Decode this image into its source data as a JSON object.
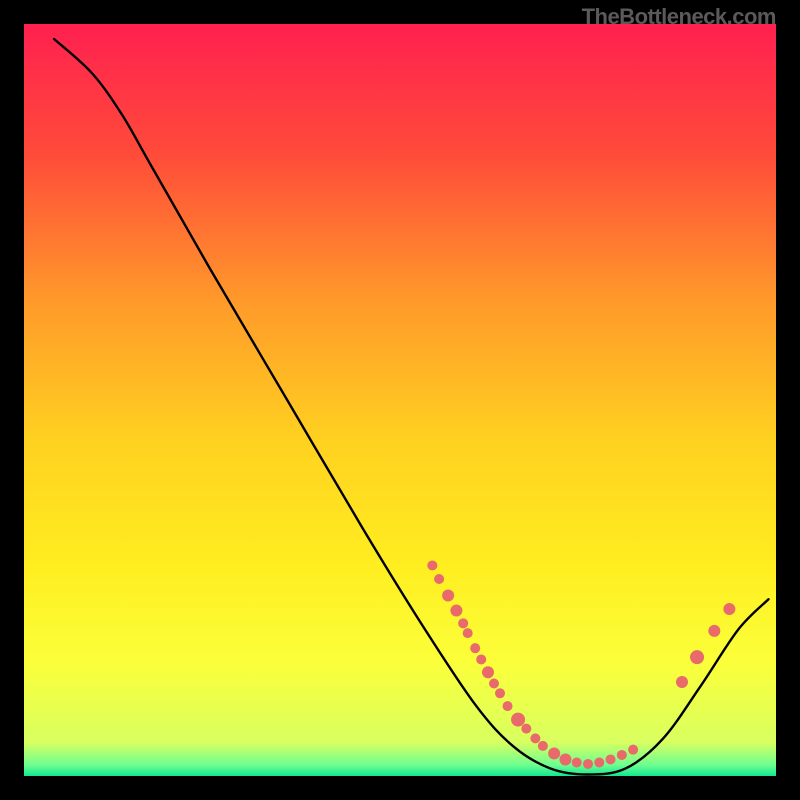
{
  "watermark": "TheBottleneck.com",
  "chart_data": {
    "type": "line",
    "title": "",
    "xlabel": "",
    "ylabel": "",
    "xlim": [
      0,
      100
    ],
    "ylim": [
      0,
      100
    ],
    "gradient_stops": [
      {
        "offset": 0.0,
        "color": "#ff2050"
      },
      {
        "offset": 0.17,
        "color": "#ff4a3a"
      },
      {
        "offset": 0.37,
        "color": "#ff9a2a"
      },
      {
        "offset": 0.55,
        "color": "#ffd020"
      },
      {
        "offset": 0.72,
        "color": "#ffee20"
      },
      {
        "offset": 0.85,
        "color": "#fbff3a"
      },
      {
        "offset": 0.955,
        "color": "#d8ff60"
      },
      {
        "offset": 0.985,
        "color": "#70ff90"
      },
      {
        "offset": 1.0,
        "color": "#10e890"
      }
    ],
    "curve": [
      {
        "x": 4.0,
        "y": 98.0
      },
      {
        "x": 9.0,
        "y": 93.5
      },
      {
        "x": 13.0,
        "y": 88.0
      },
      {
        "x": 17.0,
        "y": 81.0
      },
      {
        "x": 25.0,
        "y": 67.0
      },
      {
        "x": 35.0,
        "y": 50.0
      },
      {
        "x": 45.0,
        "y": 33.0
      },
      {
        "x": 53.0,
        "y": 20.0
      },
      {
        "x": 60.0,
        "y": 9.5
      },
      {
        "x": 65.0,
        "y": 4.0
      },
      {
        "x": 70.0,
        "y": 1.0
      },
      {
        "x": 75.0,
        "y": 0.2
      },
      {
        "x": 80.0,
        "y": 1.0
      },
      {
        "x": 85.0,
        "y": 5.0
      },
      {
        "x": 90.0,
        "y": 12.0
      },
      {
        "x": 95.0,
        "y": 19.5
      },
      {
        "x": 99.0,
        "y": 23.5
      }
    ],
    "points": [
      {
        "x": 54.3,
        "y": 28.0,
        "r": 5
      },
      {
        "x": 55.2,
        "y": 26.2,
        "r": 5
      },
      {
        "x": 56.4,
        "y": 24.0,
        "r": 6
      },
      {
        "x": 57.5,
        "y": 22.0,
        "r": 6
      },
      {
        "x": 58.4,
        "y": 20.3,
        "r": 5
      },
      {
        "x": 59.0,
        "y": 19.0,
        "r": 5
      },
      {
        "x": 60.0,
        "y": 17.0,
        "r": 5
      },
      {
        "x": 60.8,
        "y": 15.5,
        "r": 5
      },
      {
        "x": 61.7,
        "y": 13.8,
        "r": 6
      },
      {
        "x": 62.5,
        "y": 12.3,
        "r": 5
      },
      {
        "x": 63.3,
        "y": 11.0,
        "r": 5
      },
      {
        "x": 64.3,
        "y": 9.3,
        "r": 5
      },
      {
        "x": 65.7,
        "y": 7.5,
        "r": 7
      },
      {
        "x": 66.8,
        "y": 6.3,
        "r": 5
      },
      {
        "x": 68.0,
        "y": 5.0,
        "r": 5
      },
      {
        "x": 69.0,
        "y": 4.0,
        "r": 5
      },
      {
        "x": 70.5,
        "y": 3.0,
        "r": 6
      },
      {
        "x": 72.0,
        "y": 2.2,
        "r": 6
      },
      {
        "x": 73.5,
        "y": 1.8,
        "r": 5
      },
      {
        "x": 75.0,
        "y": 1.6,
        "r": 5
      },
      {
        "x": 76.5,
        "y": 1.8,
        "r": 5
      },
      {
        "x": 78.0,
        "y": 2.2,
        "r": 5
      },
      {
        "x": 79.5,
        "y": 2.8,
        "r": 5
      },
      {
        "x": 81.0,
        "y": 3.5,
        "r": 5
      },
      {
        "x": 87.5,
        "y": 12.5,
        "r": 6
      },
      {
        "x": 89.5,
        "y": 15.8,
        "r": 7
      },
      {
        "x": 91.8,
        "y": 19.3,
        "r": 6
      },
      {
        "x": 93.8,
        "y": 22.2,
        "r": 6
      }
    ],
    "curve_color": "#000000",
    "curve_width": 2.4,
    "point_color": "#e86a6a"
  }
}
